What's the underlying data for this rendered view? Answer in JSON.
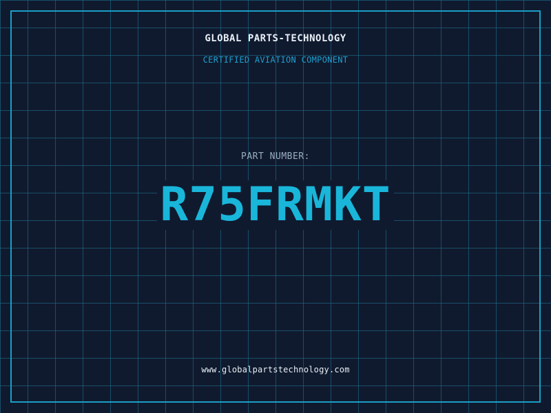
{
  "header": {
    "company": "GLOBAL PARTS-TECHNOLOGY",
    "subtitle": "CERTIFIED AVIATION COMPONENT"
  },
  "part": {
    "label": "PART NUMBER:",
    "number": "R75FRMKT"
  },
  "footer": {
    "website": "www.globalpartstechnology.com"
  },
  "colors": {
    "background": "#101a2e",
    "grid": "#1e7896",
    "frame": "#1aa0c8",
    "accent": "#19b6da",
    "text": "#e6eef5",
    "muted": "#9aaec0"
  }
}
